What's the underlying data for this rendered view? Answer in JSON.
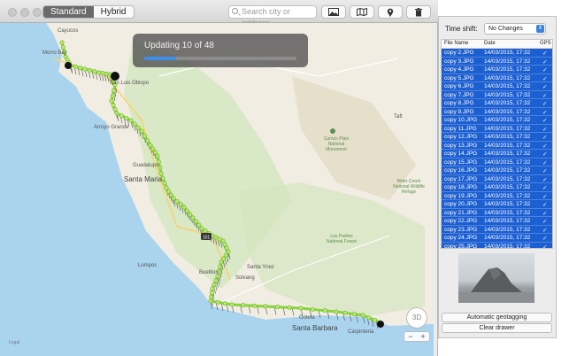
{
  "toolbar": {
    "map_modes": [
      "Standard",
      "Hybrid"
    ],
    "selected_mode": "Standard",
    "search_placeholder": "Search city or address",
    "buttons": [
      "photo-icon",
      "map-icon",
      "pin-icon",
      "trash-icon"
    ]
  },
  "map": {
    "progress": {
      "label": "Updating 10 of 48",
      "fraction": 0.208
    },
    "places": [
      "Cayucos",
      "Morro Bay",
      "San Luis Obispo",
      "Arroyo Grande",
      "Guadalupe",
      "Santa Maria",
      "Carrizo Plain National Monument",
      "Taft",
      "Bitter Creek National Wildlife Refuge",
      "Los Padres National Forest",
      "Buellton",
      "Santa Ynez",
      "Lompoc",
      "Solvang",
      "Goleta",
      "Santa Barbara",
      "Carpinteria"
    ],
    "compass_label": "3D",
    "zoom_out": "−",
    "zoom_in": "+",
    "legal": "Legal",
    "highway": "101"
  },
  "drawer": {
    "time_shift_label": "Time shift:",
    "time_shift_value": "No Changes",
    "columns": [
      "File Name",
      "Date",
      "GPS"
    ],
    "rows": [
      {
        "name": "copy 2.JPG",
        "date": "14/03/2015, 17:32"
      },
      {
        "name": "copy 3.JPG",
        "date": "14/03/2015, 17:32"
      },
      {
        "name": "copy 4.JPG",
        "date": "14/03/2015, 17:32"
      },
      {
        "name": "copy 5.JPG",
        "date": "14/03/2015, 17:32"
      },
      {
        "name": "copy 6.JPG",
        "date": "14/03/2015, 17:32"
      },
      {
        "name": "copy 7.JPG",
        "date": "14/03/2015, 17:32"
      },
      {
        "name": "copy 8.JPG",
        "date": "14/03/2015, 17:32"
      },
      {
        "name": "copy 9.JPG",
        "date": "14/03/2015, 17:32"
      },
      {
        "name": "copy 10.JPG",
        "date": "14/03/2015, 17:32"
      },
      {
        "name": "copy 11.JPG",
        "date": "14/03/2015, 17:32"
      },
      {
        "name": "copy 12.JPG",
        "date": "14/03/2015, 17:32"
      },
      {
        "name": "copy 13.JPG",
        "date": "14/03/2015, 17:32"
      },
      {
        "name": "copy 14.JPG",
        "date": "14/03/2015, 17:32"
      },
      {
        "name": "copy 15.JPG",
        "date": "14/03/2015, 17:32"
      },
      {
        "name": "copy 16.JPG",
        "date": "14/03/2015, 17:32"
      },
      {
        "name": "copy 17.JPG",
        "date": "14/03/2015, 17:32"
      },
      {
        "name": "copy 18.JPG",
        "date": "14/03/2015, 17:32"
      },
      {
        "name": "copy 19.JPG",
        "date": "14/03/2015, 17:32"
      },
      {
        "name": "copy 20.JPG",
        "date": "14/03/2015, 17:32"
      },
      {
        "name": "copy 21.JPG",
        "date": "14/03/2015, 17:32"
      },
      {
        "name": "copy 22.JPG",
        "date": "14/03/2015, 17:32"
      },
      {
        "name": "copy 23.JPG",
        "date": "14/03/2015, 17:32"
      },
      {
        "name": "copy 24.JPG",
        "date": "14/03/2015, 17:32"
      },
      {
        "name": "copy 25.JPG",
        "date": "14/03/2015, 17:32"
      }
    ],
    "gps_mark": "✓",
    "auto_geotag_label": "Automatic geotagging",
    "clear_drawer_label": "Clear drawer"
  },
  "colors": {
    "selection": "#1c5fd1",
    "track": "#8ad33e",
    "progress": "#3b8fe8"
  }
}
